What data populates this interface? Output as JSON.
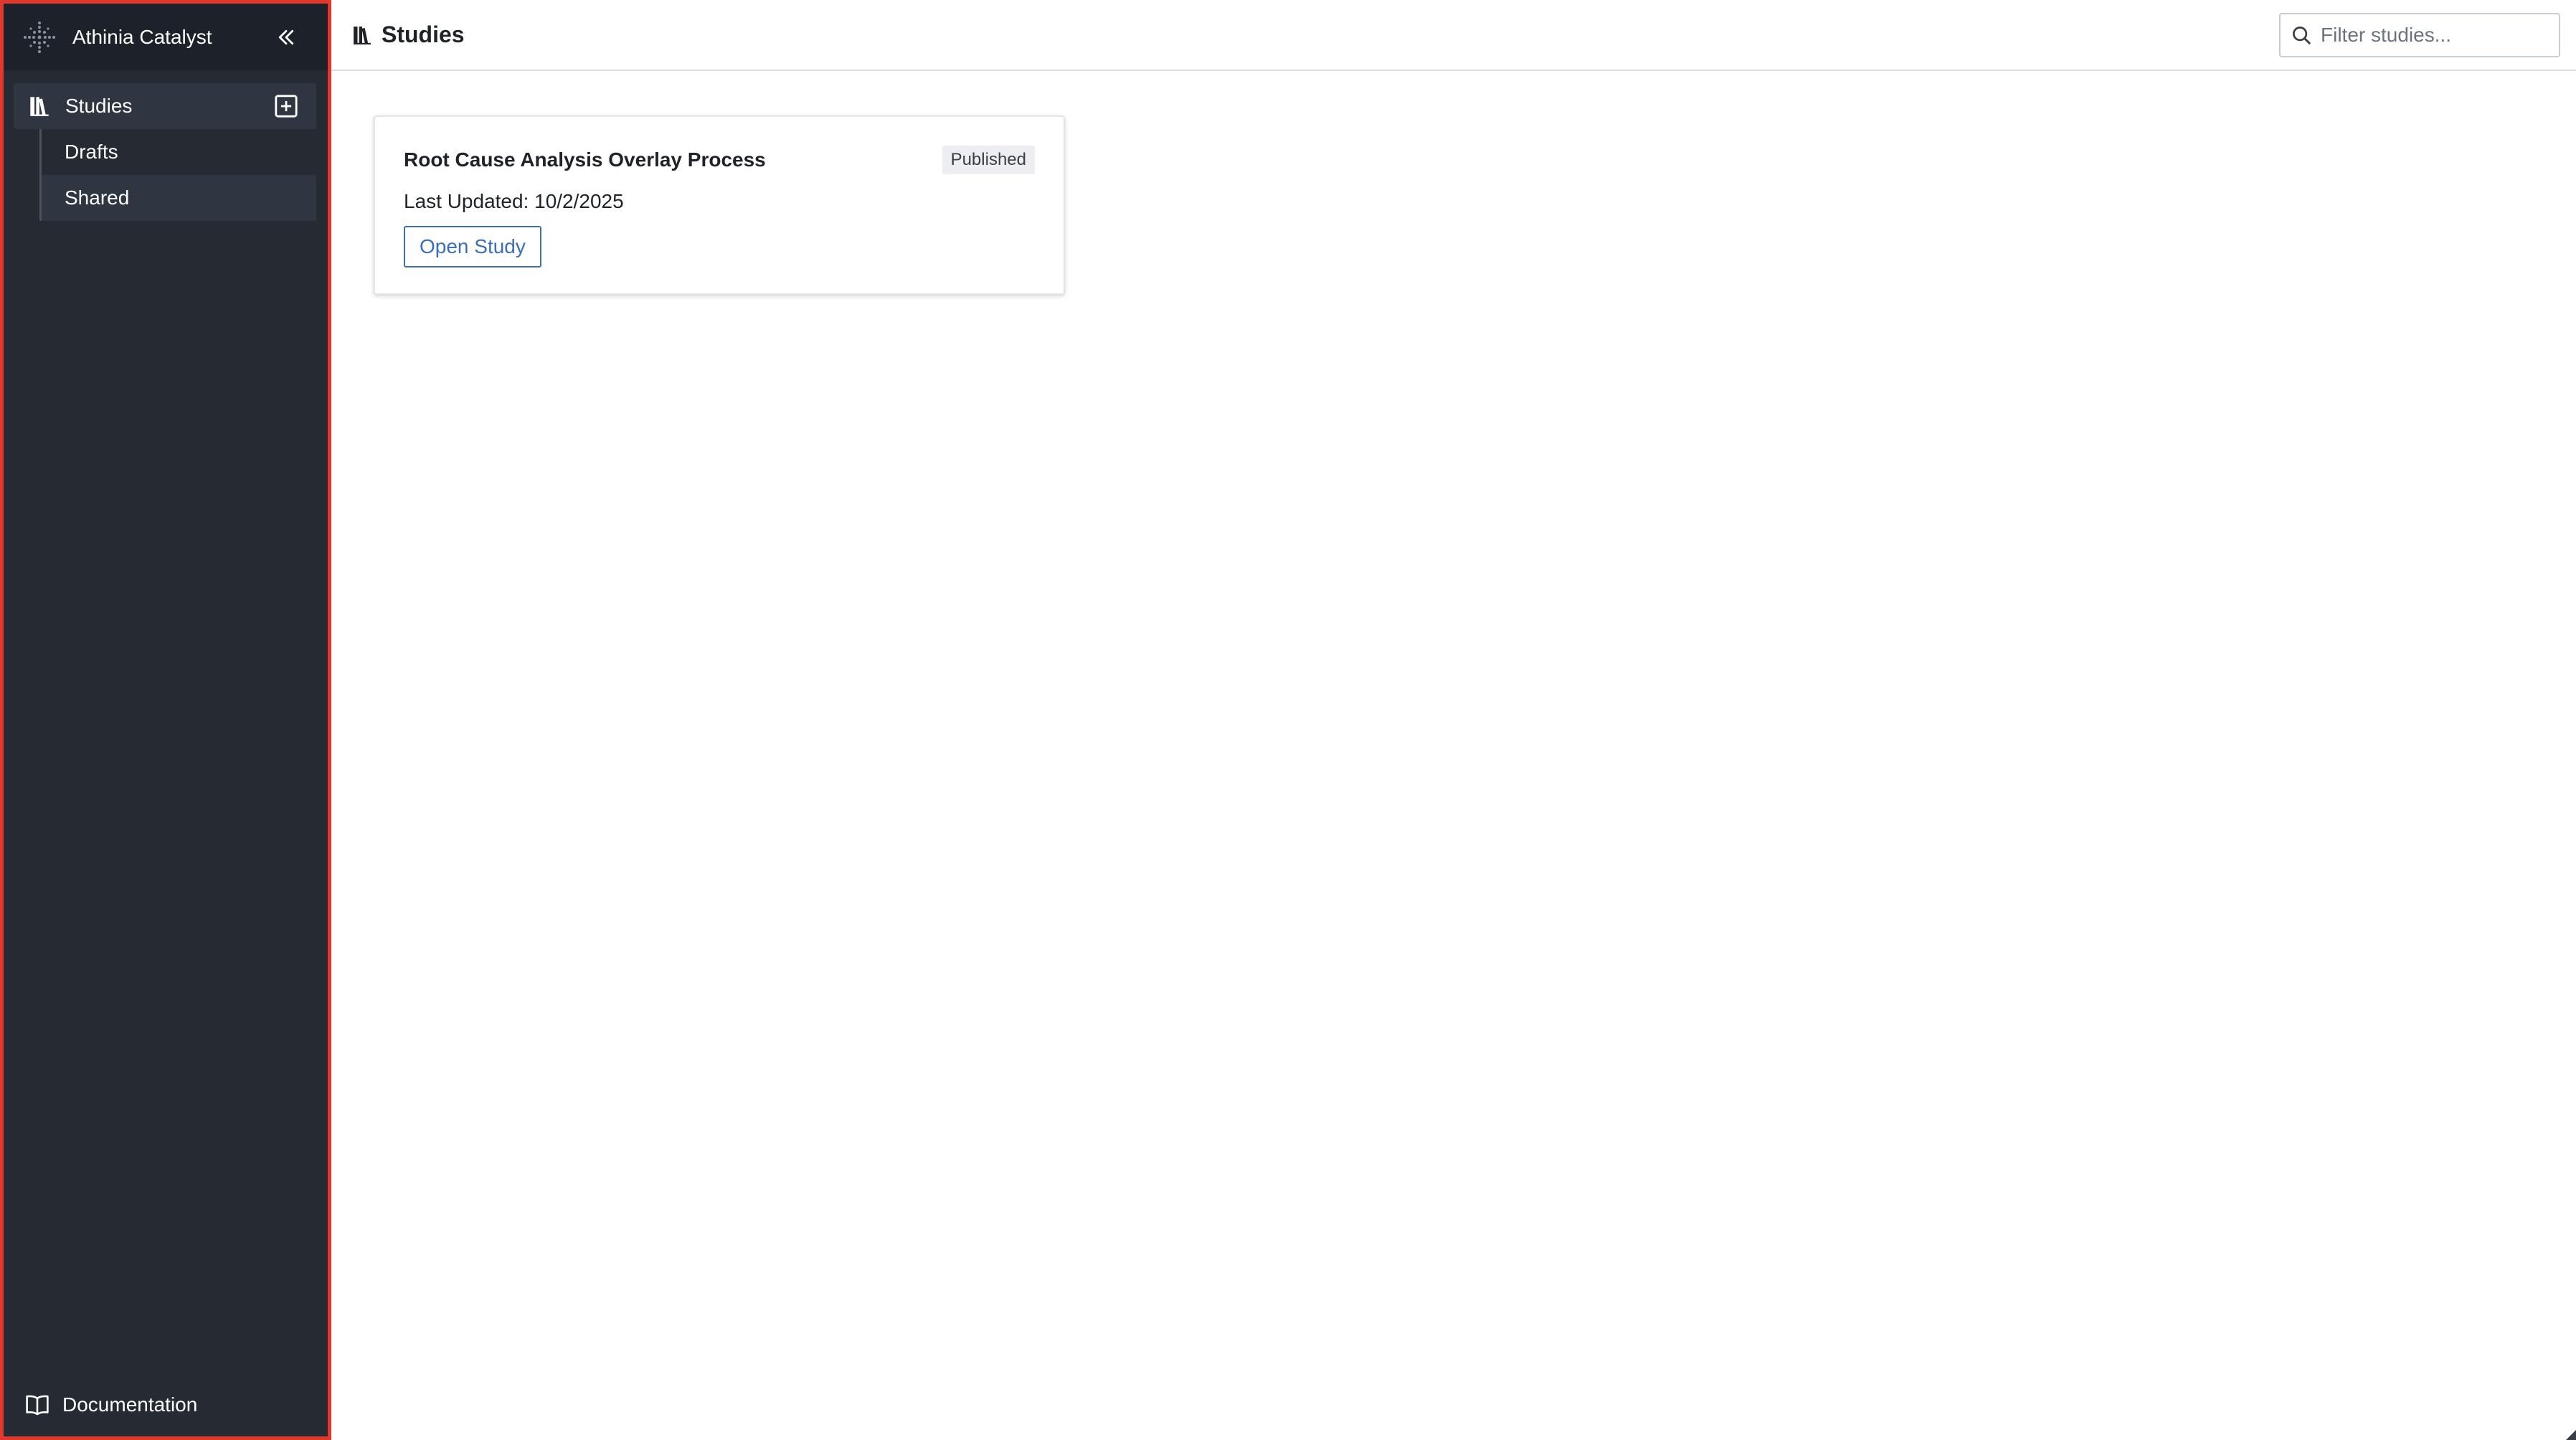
{
  "app": {
    "brand_name": "Athinia Catalyst"
  },
  "sidebar": {
    "studies_label": "Studies",
    "sub_items": [
      {
        "label": "Drafts",
        "active": false
      },
      {
        "label": "Shared",
        "active": true
      }
    ],
    "footer_label": "Documentation"
  },
  "header": {
    "title": "Studies",
    "filter_placeholder": "Filter studies..."
  },
  "studies": [
    {
      "title": "Root Cause Analysis Overlay Process",
      "status": "Published",
      "last_updated": "Last Updated: 10/2/2025",
      "open_label": "Open Study"
    }
  ],
  "colors": {
    "sidebar_bg": "#252a33",
    "sidebar_header_bg": "#1d2129",
    "highlight_border": "#e0392b",
    "accent": "#3b6fb6"
  },
  "icons": {
    "brand": "catalyst-logo-icon",
    "collapse": "chevrons-left-icon",
    "studies": "library-icon",
    "add": "plus-square-icon",
    "documentation": "open-book-icon",
    "search": "search-icon"
  }
}
